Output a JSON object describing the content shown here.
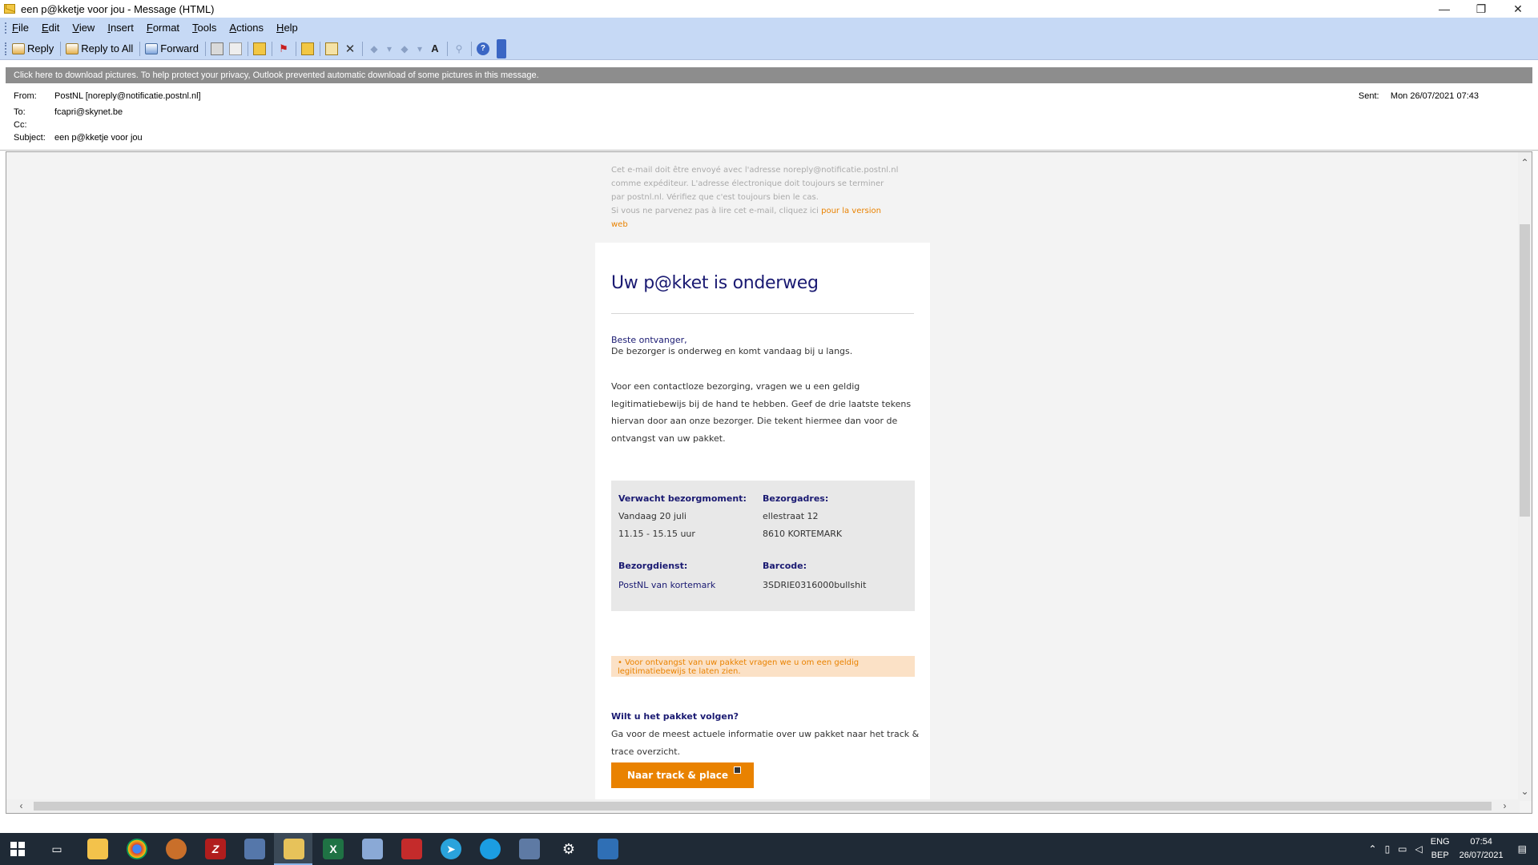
{
  "window": {
    "title": "een p@kketje voor jou - Message (HTML)",
    "minimize": "—",
    "restore": "❐",
    "close": "✕"
  },
  "menu": [
    "File",
    "Edit",
    "View",
    "Insert",
    "Format",
    "Tools",
    "Actions",
    "Help"
  ],
  "toolbar": {
    "reply": "Reply",
    "reply_all": "Reply to All",
    "forward": "Forward"
  },
  "infobar": "Click here to download pictures. To help protect your privacy, Outlook prevented automatic download of some pictures in this message.",
  "headers": {
    "from_label": "From:",
    "from": "PostNL [noreply@notificatie.postnl.nl]",
    "to_label": "To:",
    "to": "fcapri@skynet.be",
    "cc_label": "Cc:",
    "cc": "",
    "subject_label": "Subject:",
    "subject": "een p@kketje voor jou",
    "sent_label": "Sent:",
    "sent": "Mon 26/07/2021 07:43"
  },
  "email": {
    "preheader_1": "Cet e-mail doit être envoyé avec l'adresse noreply@notificatie.postnl.nl comme expéditeur. L'adresse électronique doit toujours se terminer par postnl.nl. Vérifiez que c'est toujours bien le cas.",
    "preheader_2": "Si vous ne parvenez pas à lire cet e-mail, cliquez ici",
    "preheader_link": "pour la version web",
    "heading": "Uw p@kket is onderweg",
    "greeting": "Beste ontvanger,",
    "para_1": "De bezorger is onderweg en komt vandaag bij u langs.",
    "para_2": "Voor een contactloze bezorging, vragen we u een geldig legitimatiebewijs bij de hand te hebben. Geef de drie laatste tekens hiervan door aan onze bezorger. Die tekent hiermee dan voor de ontvangst van uw pakket.",
    "info": {
      "moment_label": "Verwacht bezorgmoment:",
      "moment_day": "Vandaag 20 juli",
      "moment_time": "11.15 - 15.15 uur",
      "address_label": "Bezorgadres:",
      "address_street": "ellestraat 12",
      "address_city": "8610 KORTEMARK",
      "service_label": "Bezorgdienst:",
      "service": "PostNL van kortemark",
      "barcode_label": "Barcode:",
      "barcode": "3SDRIE0316000bullshit"
    },
    "notice": "• Voor ontvangst van uw pakket vragen we u om een geldig legitimatiebewijs te laten zien.",
    "follow_heading": "Wilt u het pakket volgen?",
    "follow_text": "Ga voor de meest actuele informatie over uw pakket naar het track & trace overzicht.",
    "button": "Naar track & place"
  },
  "taskbar": {
    "lang_1": "ENG",
    "lang_2": "BEP",
    "time": "07:54",
    "date": "26/07/2021"
  },
  "colors": {
    "postnl_navy": "#1a1a72",
    "postnl_orange": "#e98200",
    "outlook_bar": "#c6d9f5"
  }
}
